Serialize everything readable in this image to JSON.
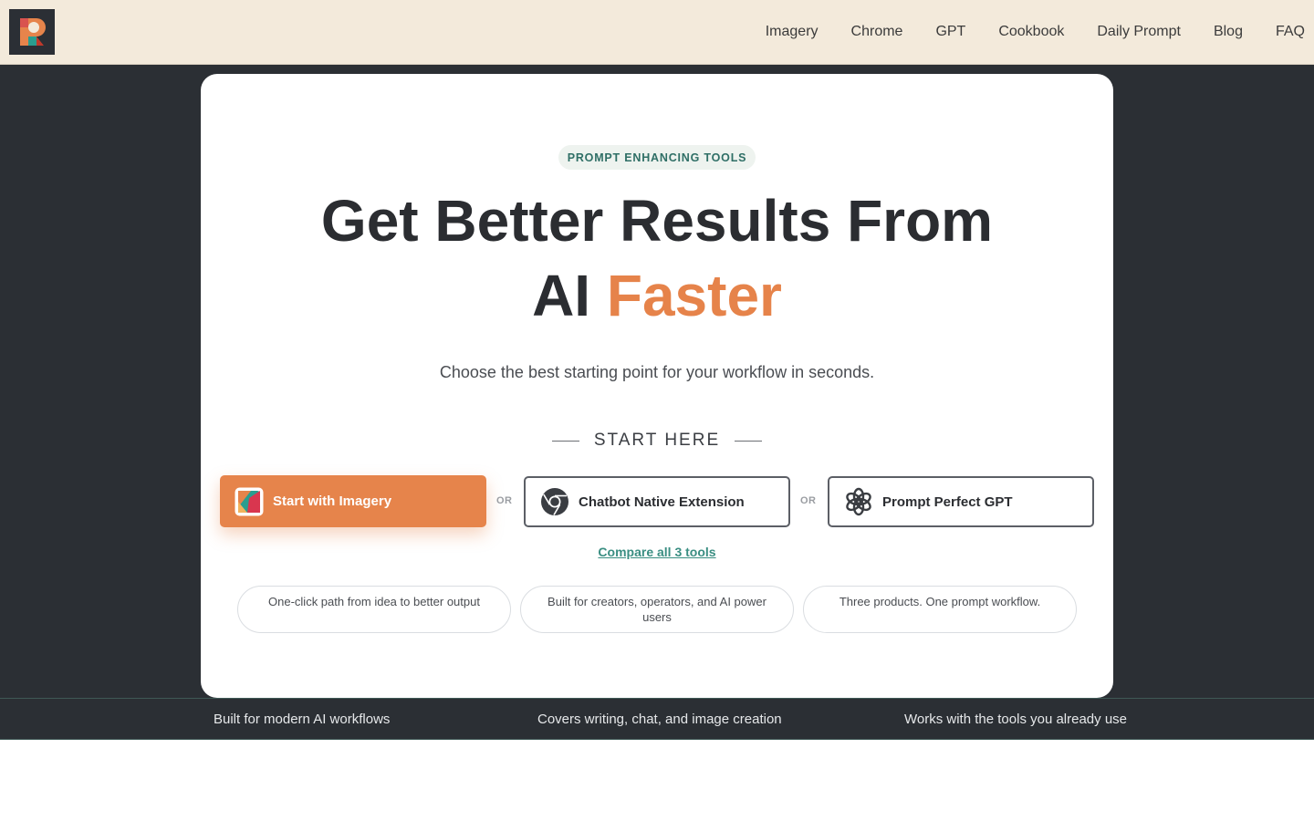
{
  "nav": {
    "items": [
      {
        "label": "Imagery"
      },
      {
        "label": "Chrome"
      },
      {
        "label": "GPT"
      },
      {
        "label": "Cookbook"
      },
      {
        "label": "Daily Prompt"
      },
      {
        "label": "Blog"
      },
      {
        "label": "FAQ"
      }
    ]
  },
  "hero": {
    "badge": "PROMPT ENHANCING TOOLS",
    "headline_line1": "Get Better Results From",
    "headline_line2_prefix": "AI",
    "headline_line2_accent": "Faster",
    "subtitle": "Choose the best starting point for your workflow in seconds.",
    "start_here": "START HERE",
    "cta_primary": "Start with Imagery",
    "cta_secondary": "Chatbot Native Extension",
    "cta_tertiary": "Prompt Perfect GPT",
    "or_label": "OR",
    "compare_link": "Compare all 3 tools",
    "pills": [
      "One-click path from idea to better output",
      "Built for creators, operators, and AI power users",
      "Three products. One prompt workflow."
    ]
  },
  "strip": {
    "items": [
      "Built for modern AI workflows",
      "Covers writing, chat, and image creation",
      "Works with the tools you already use"
    ]
  },
  "colors": {
    "accent": "#e6834a",
    "dark_bg": "#2b2f34",
    "topbar_bg": "#f3eadb",
    "link": "#3a8e82"
  },
  "icons": {
    "logo": "brand-logo-icon",
    "imagery": "imagery-app-icon",
    "chrome": "chrome-icon",
    "openai": "openai-icon"
  }
}
